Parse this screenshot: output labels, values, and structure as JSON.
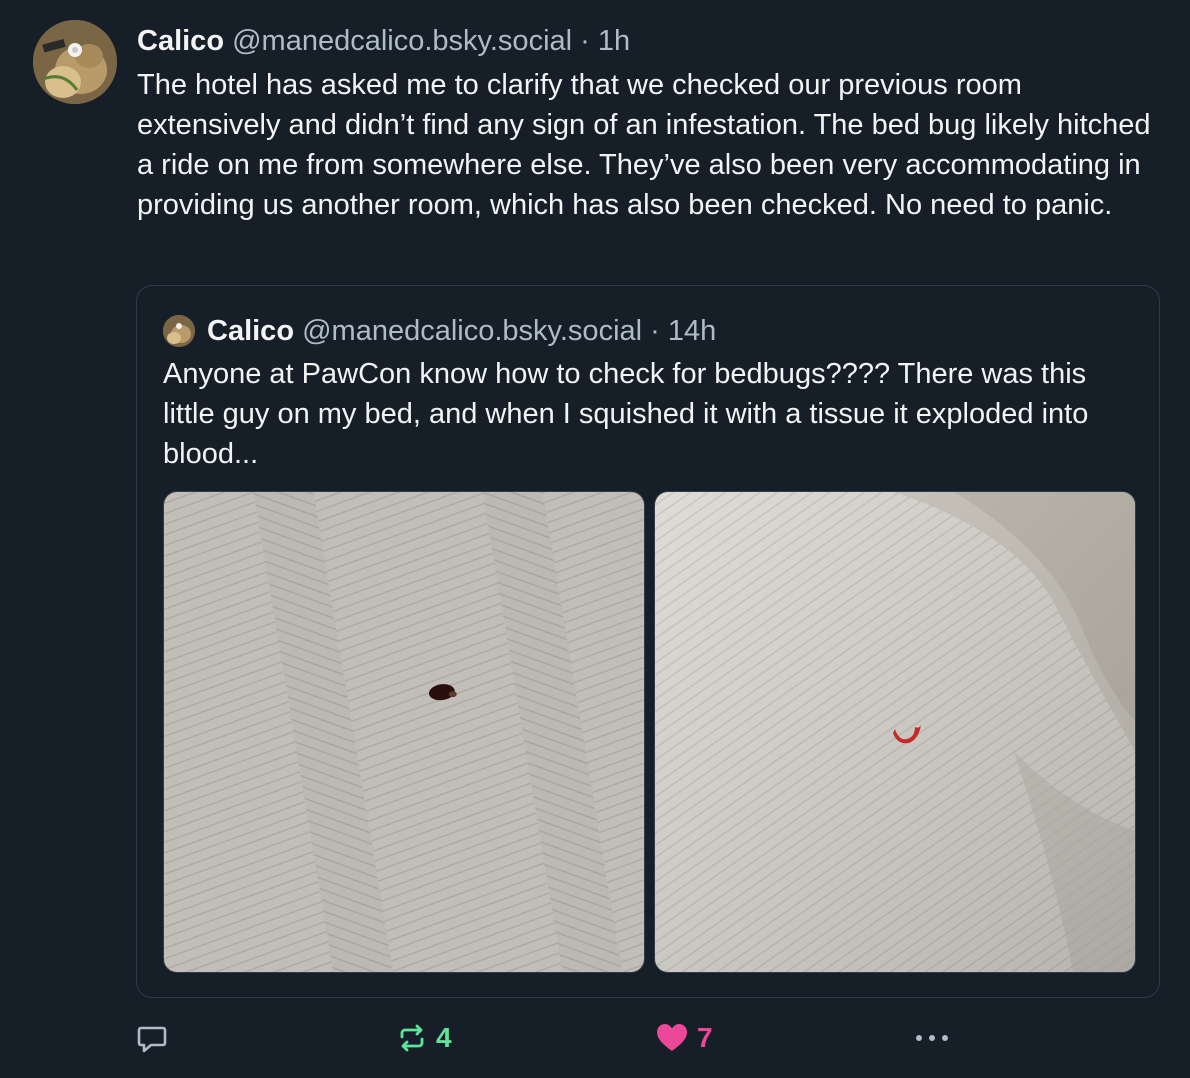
{
  "post": {
    "author_name": "Calico",
    "author_handle": "@manedcalico.bsky.social",
    "time": "· 1h",
    "text": "The hotel has asked me to clarify that we checked our previous room extensively and didn’t find any sign of an infestation. The bed bug likely hitched a ride on me from somewhere else. They’ve also been very accommodating in providing us another room, which has also been checked. No need to panic."
  },
  "quote": {
    "author_name": "Calico",
    "author_handle": "@manedcalico.bsky.social",
    "time": "· 14h",
    "text": "Anyone at PawCon know how to check for bedbugs???? There was this little guy on my bed, and when I squished it with a tissue it exploded into blood..."
  },
  "actions": {
    "reply_count": "",
    "repost_count": "4",
    "like_count": "7",
    "repost_color": "#5fe39a",
    "like_color": "#ec4899"
  }
}
